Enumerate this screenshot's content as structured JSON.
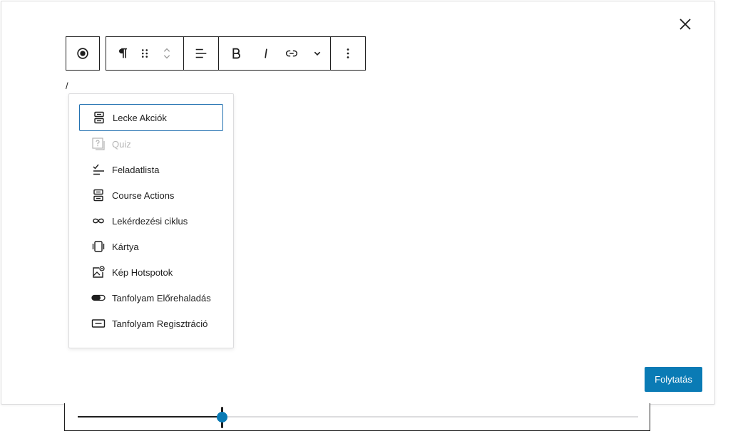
{
  "modal": {
    "close_icon": "close-icon",
    "continue_label": "Folytatás",
    "accent_color": "#0a7bb5"
  },
  "toolbar": {
    "groups": [
      [
        "record-icon"
      ],
      [
        "paragraph-icon",
        "drag-handle-icon",
        "move-up-down-icon"
      ],
      [
        "align-left-icon"
      ],
      [
        "bold-icon",
        "italic-icon",
        "link-icon",
        "chevron-down-icon"
      ],
      [
        "more-options-icon"
      ]
    ]
  },
  "editor": {
    "slash_text": "/"
  },
  "inserter": {
    "items": [
      {
        "label": "Lecke Akciók",
        "icon": "stack-icon",
        "selected": true,
        "disabled": false
      },
      {
        "label": "Quiz",
        "icon": "quiz-icon",
        "selected": false,
        "disabled": true
      },
      {
        "label": "Feladatlista",
        "icon": "checklist-icon",
        "selected": false,
        "disabled": false
      },
      {
        "label": "Course Actions",
        "icon": "stack-icon",
        "selected": false,
        "disabled": false
      },
      {
        "label": "Lekérdezési ciklus",
        "icon": "loop-icon",
        "selected": false,
        "disabled": false
      },
      {
        "label": "Kártya",
        "icon": "card-icon",
        "selected": false,
        "disabled": false
      },
      {
        "label": "Kép Hotspotok",
        "icon": "image-hotspot-icon",
        "selected": false,
        "disabled": false
      },
      {
        "label": "Tanfolyam Előrehaladás",
        "icon": "progress-toggle-icon",
        "selected": false,
        "disabled": false
      },
      {
        "label": "Tanfolyam Regisztráció",
        "icon": "button-icon",
        "selected": false,
        "disabled": false
      }
    ]
  },
  "slider": {
    "value_fraction": 0.257
  }
}
